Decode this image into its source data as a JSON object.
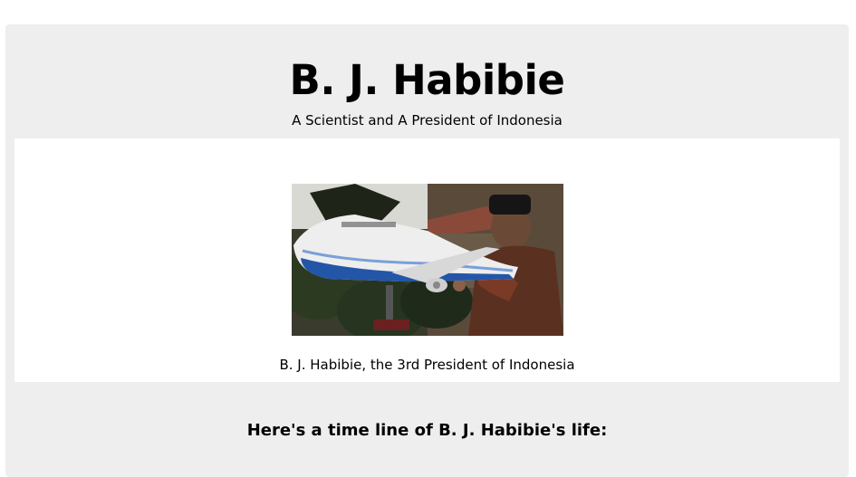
{
  "header": {
    "title": "B. J. Habibie",
    "subtitle": "A Scientist and A President of Indonesia"
  },
  "image_panel": {
    "caption": "B. J. Habibie, the 3rd President of Indonesia"
  },
  "timeline": {
    "heading": "Here's a time line of B. J. Habibie's life:"
  }
}
